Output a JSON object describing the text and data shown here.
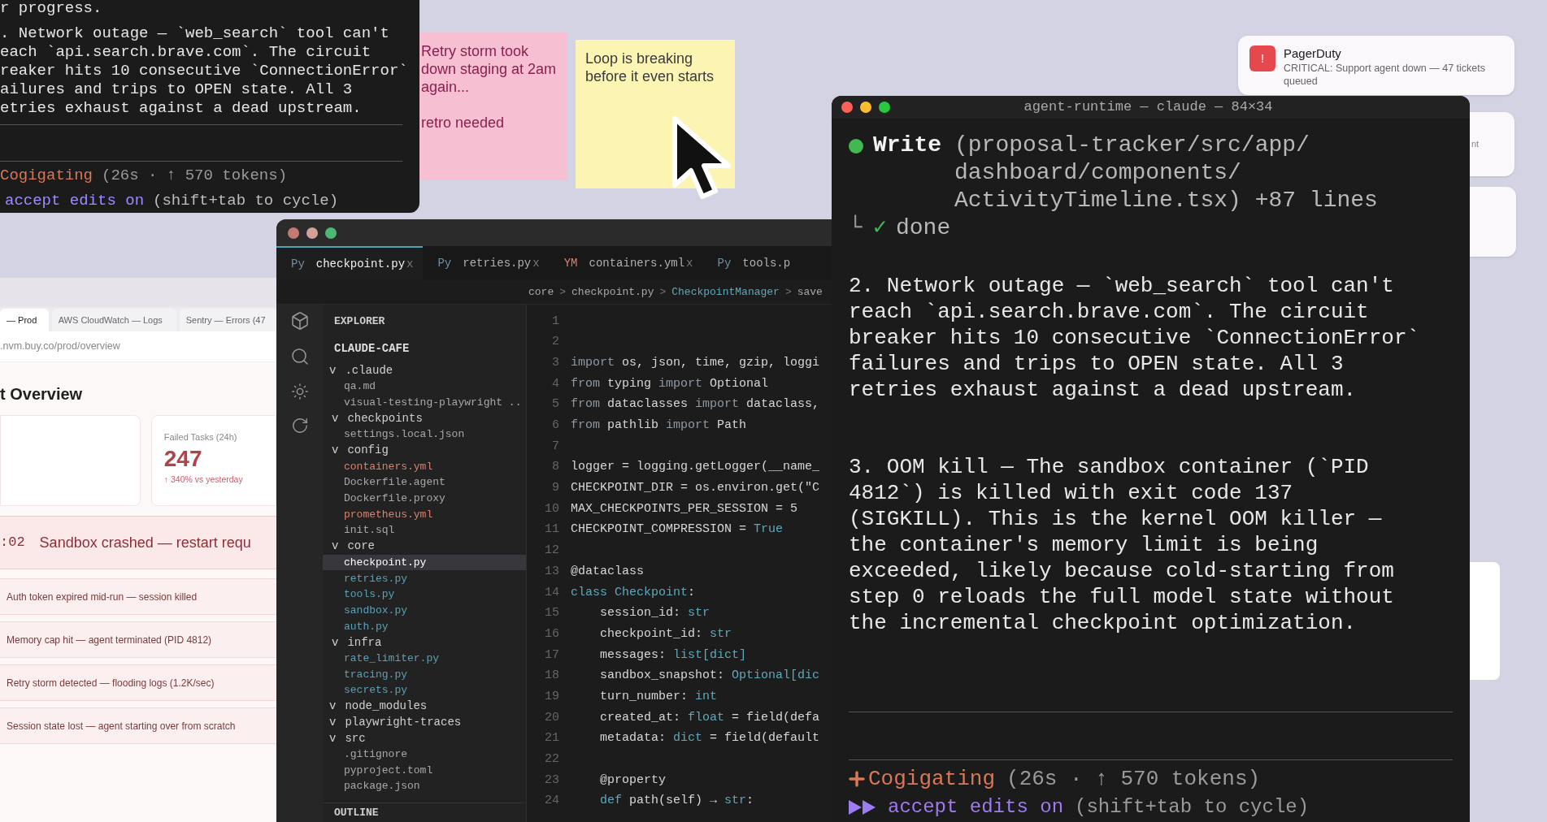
{
  "terminal_top": {
    "top_line": "r progress.",
    "lines": [
      ". Network outage — `web_search` tool can't",
      "each `api.search.brave.com`. The circuit",
      "reaker hits 10 consecutive `ConnectionError`",
      "ailures and trips to OPEN state. All 3",
      "etries exhaust against a dead upstream."
    ],
    "status": {
      "verb": "Cogigating",
      "detail": "(26s · ↑ 570 tokens)"
    },
    "mode": {
      "label": "accept edits on",
      "hint": "(shift+tab to cycle)"
    }
  },
  "sticky_notes": [
    {
      "color": "#f7bfd2",
      "lines": [
        "Retry storm took down staging at 2am again...",
        "retro needed"
      ]
    },
    {
      "color": "#fcf4b3",
      "lines": [
        "Loop is breaking before it even starts"
      ]
    }
  ],
  "notifications": [
    {
      "kind": "full",
      "icon": "!",
      "app": "PagerDuty",
      "text": "CRITICAL: Support agent down — 47 tickets queued"
    },
    {
      "kind": "partial",
      "text": "nt"
    },
    {
      "kind": "blank"
    }
  ],
  "terminal_main": {
    "title": "agent-runtime — claude — 84×34",
    "write": {
      "tool": "Write",
      "path": "(proposal-tracker/src/app/ dashboard/components/ ActivityTimeline.tsx) +87 lines"
    },
    "result": {
      "corner": "└",
      "check": "✓",
      "text": "done"
    },
    "paragraphs": [
      "2. Network outage — `web_search` tool can't reach `api.search.brave.com`. The circuit breaker hits 10 consecutive `ConnectionError` failures and trips to OPEN state. All 3 retries exhaust against a dead upstream.",
      "3. OOM kill — The sandbox container (`PID 4812`) is killed with exit code 137 (SIGKILL). This is the kernel OOM killer — the container's memory limit is being exceeded, likely because cold-starting from step 0 reloads the full model state without the incremental checkpoint optimization."
    ],
    "status": {
      "verb": "Cogigating",
      "detail": "(26s · ↑ 570 tokens)"
    },
    "mode": {
      "label": "accept edits on",
      "hint": "(shift+tab to cycle)"
    }
  },
  "browser": {
    "tabs": [
      {
        "label": "— Prod",
        "selected": true
      },
      {
        "label": "AWS CloudWatch — Logs",
        "selected": false
      },
      {
        "label": "Sentry — Errors (47",
        "selected": false
      }
    ],
    "url": ".nvm.buy.co/prod/overview",
    "heading": "t Overview",
    "stat": {
      "label": "Failed Tasks (24h)",
      "value": "247",
      "change": "↑ 340% vs yesterday"
    },
    "alert": {
      "time": ":02",
      "text": "Sandbox crashed — restart requ"
    },
    "events": [
      "Auth token expired mid-run — session killed",
      "Memory cap hit — agent terminated (PID 4812)",
      "Retry storm detected — flooding logs (1.2K/sec)",
      "Session state lost — agent starting over from scratch"
    ]
  },
  "editor": {
    "tabs": [
      {
        "badge": "Py",
        "color": "#6f8fa0",
        "name": "checkpoint.py",
        "close": "x",
        "selected": true
      },
      {
        "badge": "Py",
        "color": "#6f8fa0",
        "name": "retries.py",
        "close": "x",
        "selected": false
      },
      {
        "badge": "YM",
        "color": "#d9826f",
        "name": "containers.yml",
        "close": "x",
        "selected": false
      },
      {
        "badge": "Py",
        "color": "#6f8fa0",
        "name": "tools.p",
        "selected": false
      }
    ],
    "breadcrumb": [
      {
        "kind": "path",
        "text": "core"
      },
      {
        "kind": "sep",
        "text": ">"
      },
      {
        "kind": "path",
        "text": "checkpoint.py"
      },
      {
        "kind": "sep",
        "text": ">"
      },
      {
        "kind": "symbol",
        "text": "CheckpointManager"
      },
      {
        "kind": "sep",
        "text": ">"
      },
      {
        "kind": "path",
        "text": "save"
      }
    ],
    "explorer": {
      "title": "EXPLORER",
      "root": "CLAUDE-CAFE",
      "outline": "OUTLINE",
      "tree": [
        {
          "toggle": "v",
          "label": ".claude",
          "selected": false,
          "children": [
            {
              "label": "qa.md",
              "color": "#a8a8a8",
              "selected": false
            },
            {
              "label": "visual-testing-playwright ..",
              "color": "#a8a8a8",
              "selected": false
            },
            {
              "toggle": "v",
              "label": "checkpoints",
              "selected": false,
              "children": [
                {
                  "label": "settings.local.json",
                  "color": "#a8a8a8",
                  "selected": false
                }
              ]
            },
            {
              "toggle": "v",
              "label": "config",
              "selected": false,
              "children": [
                {
                  "label": "containers.yml",
                  "color": "#d9826f",
                  "selected": false
                },
                {
                  "label": "Dockerfile.agent",
                  "color": "#a8a8a8",
                  "selected": false
                },
                {
                  "label": "Dockerfile.proxy",
                  "color": "#a8a8a8",
                  "selected": false
                },
                {
                  "label": "prometheus.yml",
                  "color": "#d9826f",
                  "selected": false
                },
                {
                  "label": "init.sql",
                  "color": "#a8a8a8",
                  "selected": false
                }
              ]
            },
            {
              "toggle": "v",
              "label": "core",
              "selected": false,
              "children": [
                {
                  "label": "checkpoint.py",
                  "color": "#ffffff",
                  "selected": true
                },
                {
                  "label": "retries.py",
                  "color": "#5f9eb3",
                  "selected": false
                },
                {
                  "label": "tools.py",
                  "color": "#5f9eb3",
                  "selected": false
                },
                {
                  "label": "sandbox.py",
                  "color": "#5f9eb3",
                  "selected": false
                },
                {
                  "label": "auth.py",
                  "color": "#5f9eb3",
                  "selected": false
                }
              ]
            },
            {
              "toggle": "v",
              "label": "infra",
              "selected": false,
              "children": [
                {
                  "label": "rate_limiter.py",
                  "color": "#5f9eb3",
                  "selected": false
                },
                {
                  "label": "tracing.py",
                  "color": "#5f9eb3",
                  "selected": false
                },
                {
                  "label": "secrets.py",
                  "color": "#5f9eb3",
                  "selected": false
                }
              ]
            }
          ]
        },
        {
          "toggle": "v",
          "label": "node_modules",
          "selected": false
        },
        {
          "toggle": "v",
          "label": "playwright-traces",
          "selected": false
        },
        {
          "toggle": "v",
          "label": "src",
          "selected": false,
          "children": [
            {
              "label": ".gitignore",
              "color": "#a8a8a8",
              "selected": false
            },
            {
              "label": "pyproject.toml",
              "color": "#a8a8a8",
              "selected": false
            },
            {
              "label": "package.json",
              "color": "#a8a8a8",
              "selected": false
            }
          ]
        }
      ]
    },
    "code": [
      {
        "n": "1"
      },
      {
        "n": "2"
      },
      {
        "n": "3",
        "tokens": [
          {
            "kind": "keyword",
            "text": "import"
          },
          {
            "kind": "plain",
            "text": " os, json, time, gzip, loggi"
          }
        ]
      },
      {
        "n": "4",
        "tokens": [
          {
            "kind": "keyword",
            "text": "from"
          },
          {
            "kind": "plain",
            "text": " typing "
          },
          {
            "kind": "keyword",
            "text": "import"
          },
          {
            "kind": "plain",
            "text": " Optional"
          }
        ]
      },
      {
        "n": "5",
        "tokens": [
          {
            "kind": "keyword",
            "text": "from"
          },
          {
            "kind": "plain",
            "text": " dataclasses "
          },
          {
            "kind": "keyword",
            "text": "import"
          },
          {
            "kind": "plain",
            "text": " dataclass,"
          }
        ]
      },
      {
        "n": "6",
        "tokens": [
          {
            "kind": "keyword",
            "text": "from"
          },
          {
            "kind": "plain",
            "text": " pathlib "
          },
          {
            "kind": "keyword",
            "text": "import"
          },
          {
            "kind": "plain",
            "text": " Path"
          }
        ]
      },
      {
        "n": "7"
      },
      {
        "n": "8",
        "tokens": [
          {
            "kind": "plain",
            "text": "logger = logging.getLogger(__name_"
          }
        ]
      },
      {
        "n": "9",
        "tokens": [
          {
            "kind": "plain",
            "text": "CHECKPOINT_DIR = os.environ.get(\"C"
          }
        ]
      },
      {
        "n": "10",
        "tokens": [
          {
            "kind": "plain",
            "text": "MAX_CHECKPOINTS_PER_SESSION = 5"
          }
        ]
      },
      {
        "n": "11",
        "tokens": [
          {
            "kind": "plain",
            "text": "CHECKPOINT_COMPRESSION = "
          },
          {
            "kind": "type",
            "text": "True"
          }
        ]
      },
      {
        "n": "12"
      },
      {
        "n": "13",
        "tokens": [
          {
            "kind": "plain",
            "text": "@dataclass"
          }
        ]
      },
      {
        "n": "14",
        "tokens": [
          {
            "kind": "type",
            "text": "class Checkpoint"
          },
          {
            "kind": "plain",
            "text": ":"
          }
        ]
      },
      {
        "n": "15",
        "tokens": [
          {
            "kind": "plain",
            "text": "    session_id: "
          },
          {
            "kind": "type",
            "text": "str"
          }
        ]
      },
      {
        "n": "16",
        "tokens": [
          {
            "kind": "plain",
            "text": "    checkpoint_id: "
          },
          {
            "kind": "type",
            "text": "str"
          }
        ]
      },
      {
        "n": "17",
        "tokens": [
          {
            "kind": "plain",
            "text": "    messages: "
          },
          {
            "kind": "type",
            "text": "list[dict]"
          }
        ]
      },
      {
        "n": "18",
        "tokens": [
          {
            "kind": "plain",
            "text": "    sandbox_snapshot: "
          },
          {
            "kind": "type",
            "text": "Optional[dic"
          }
        ]
      },
      {
        "n": "19",
        "tokens": [
          {
            "kind": "plain",
            "text": "    turn_number: "
          },
          {
            "kind": "type",
            "text": "int"
          }
        ]
      },
      {
        "n": "20",
        "tokens": [
          {
            "kind": "plain",
            "text": "    created_at: "
          },
          {
            "kind": "type",
            "text": "float"
          },
          {
            "kind": "plain",
            "text": " = field(defa"
          }
        ]
      },
      {
        "n": "21",
        "tokens": [
          {
            "kind": "plain",
            "text": "    metadata: "
          },
          {
            "kind": "type",
            "text": "dict"
          },
          {
            "kind": "plain",
            "text": " = field(default"
          }
        ]
      },
      {
        "n": "22"
      },
      {
        "n": "23",
        "tokens": [
          {
            "kind": "plain",
            "text": "    @property"
          }
        ]
      },
      {
        "n": "24",
        "tokens": [
          {
            "kind": "type",
            "text": "    def"
          },
          {
            "kind": "plain",
            "text": " path(self) → "
          },
          {
            "kind": "type",
            "text": "str"
          },
          {
            "kind": "plain",
            "text": ":"
          }
        ]
      }
    ]
  }
}
